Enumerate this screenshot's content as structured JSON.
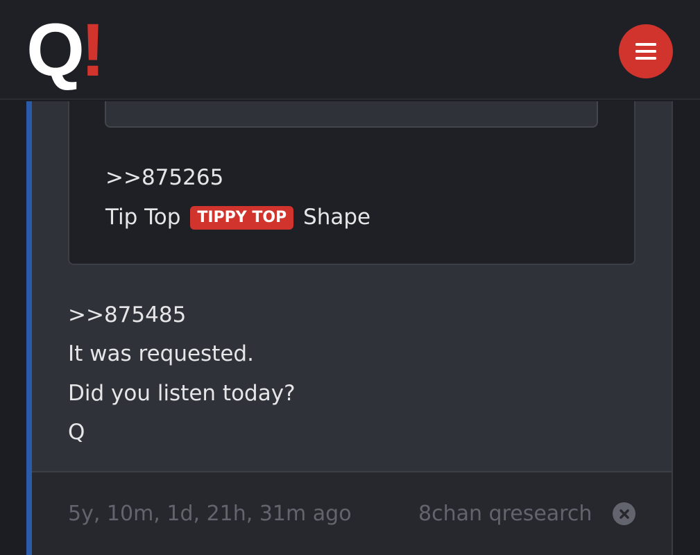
{
  "header": {
    "logo_letter": "Q",
    "logo_mark": "!",
    "menu_icon": "hamburger-menu-icon"
  },
  "quoted_post": {
    "reference": ">>875265",
    "line_before_badge": "Tip Top",
    "badge": "TIPPY TOP",
    "line_after_badge": "Shape"
  },
  "post": {
    "reference": ">>875485",
    "lines": [
      "It was requested.",
      "Did you listen today?",
      "Q"
    ]
  },
  "footer": {
    "age": "5y, 10m, 1d, 21h, 31m ago",
    "source": "8chan qresearch",
    "close_icon": "close-circle-icon"
  },
  "colors": {
    "accent_red": "#d0342c",
    "accent_blue": "#2b5aa8",
    "background": "#1c1d22",
    "card": "#303239"
  }
}
